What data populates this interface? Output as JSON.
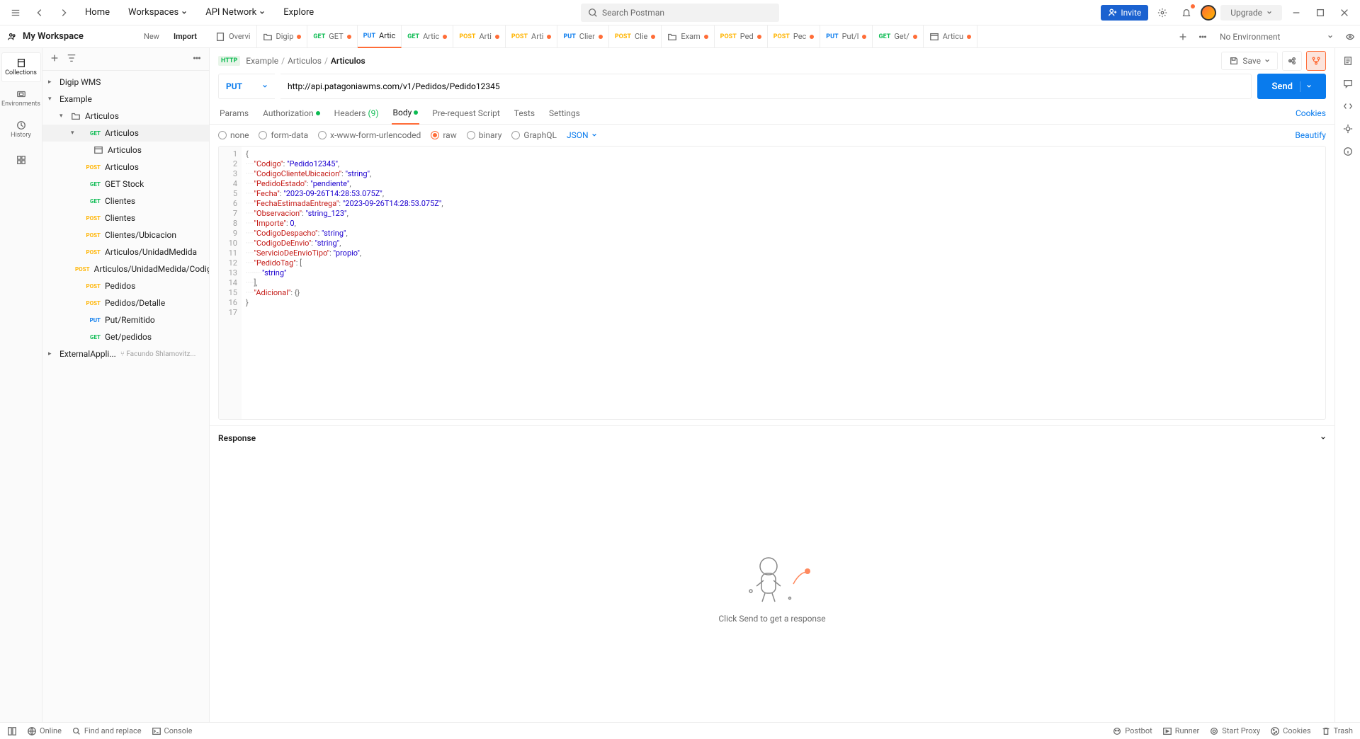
{
  "titlebar": {
    "home": "Home",
    "workspaces": "Workspaces",
    "api_network": "API Network",
    "explore": "Explore",
    "search_placeholder": "Search Postman",
    "invite": "Invite",
    "upgrade": "Upgrade"
  },
  "workspace": {
    "name": "My Workspace",
    "new": "New",
    "import": "Import"
  },
  "tabs": [
    {
      "icon": "overview",
      "label": "Overvi",
      "dot": false
    },
    {
      "icon": "folder",
      "label": "Digip",
      "dot": true
    },
    {
      "method": "GET",
      "label": "GET",
      "dot": true
    },
    {
      "method": "PUT",
      "label": "Artic",
      "dot": false,
      "active": true
    },
    {
      "method": "GET",
      "label": "Artic",
      "dot": true
    },
    {
      "method": "POST",
      "label": "Arti",
      "dot": true
    },
    {
      "method": "POST",
      "label": "Arti",
      "dot": true
    },
    {
      "method": "PUT",
      "label": "Clier",
      "dot": true
    },
    {
      "method": "POST",
      "label": "Clie",
      "dot": true
    },
    {
      "icon": "folder",
      "label": "Exam",
      "dot": true
    },
    {
      "method": "POST",
      "label": "Ped",
      "dot": true
    },
    {
      "method": "POST",
      "label": "Pec",
      "dot": true
    },
    {
      "method": "PUT",
      "label": "Put/l",
      "dot": true
    },
    {
      "method": "GET",
      "label": "Get/",
      "dot": true
    },
    {
      "icon": "example",
      "label": "Articu",
      "dot": true
    }
  ],
  "env": "No Environment",
  "leftrail": [
    {
      "label": "Collections",
      "active": true
    },
    {
      "label": "Environments"
    },
    {
      "label": "History"
    },
    {
      "label": ""
    }
  ],
  "tree": [
    {
      "level": 0,
      "arrow": "r",
      "label": "Digip WMS"
    },
    {
      "level": 0,
      "arrow": "d",
      "label": "Example"
    },
    {
      "level": 1,
      "arrow": "d",
      "folder": true,
      "label": "Articulos"
    },
    {
      "level": 2,
      "arrow": "d",
      "method": "GET",
      "label": "Articulos",
      "selected": true
    },
    {
      "level": 3,
      "example": true,
      "label": "Articulos"
    },
    {
      "level": 2,
      "method": "POST",
      "label": "Articulos"
    },
    {
      "level": 2,
      "method": "GET",
      "label": "GET Stock"
    },
    {
      "level": 2,
      "method": "GET",
      "label": "Clientes"
    },
    {
      "level": 2,
      "method": "POST",
      "label": "Clientes"
    },
    {
      "level": 2,
      "method": "POST",
      "label": "Clientes/Ubicacion"
    },
    {
      "level": 2,
      "method": "POST",
      "label": "Articulos/UnidadMedida"
    },
    {
      "level": 2,
      "method": "POST",
      "label": "Articulos/UnidadMedida/Codig..."
    },
    {
      "level": 2,
      "method": "POST",
      "label": "Pedidos"
    },
    {
      "level": 2,
      "method": "POST",
      "label": "Pedidos/Detalle"
    },
    {
      "level": 2,
      "method": "PUT",
      "label": "Put/Remitido"
    },
    {
      "level": 2,
      "method": "GET",
      "label": "Get/pedidos"
    },
    {
      "level": 0,
      "arrow": "r",
      "label": "ExternalAppli...",
      "fork": "Facundo Shlamovitz..."
    }
  ],
  "breadcrumb": {
    "badge": "HTTP",
    "parts": [
      "Example",
      "Articulos"
    ],
    "current": "Articulos"
  },
  "save": "Save",
  "request": {
    "method": "PUT",
    "url": "http://api.patagoniawms.com/v1/Pedidos/Pedido12345",
    "send": "Send"
  },
  "req_tabs": [
    {
      "label": "Params"
    },
    {
      "label": "Authorization",
      "ind": true
    },
    {
      "label": "Headers",
      "count": "(9)"
    },
    {
      "label": "Body",
      "ind": true,
      "active": true
    },
    {
      "label": "Pre-request Script"
    },
    {
      "label": "Tests"
    },
    {
      "label": "Settings"
    }
  ],
  "cookies": "Cookies",
  "body_types": [
    {
      "label": "none"
    },
    {
      "label": "form-data"
    },
    {
      "label": "x-www-form-urlencoded"
    },
    {
      "label": "raw",
      "sel": true
    },
    {
      "label": "binary"
    },
    {
      "label": "GraphQL"
    }
  ],
  "body_format": "JSON",
  "beautify": "Beautify",
  "code_lines": [
    {
      "n": 1,
      "tokens": [
        {
          "t": "p",
          "v": "{"
        }
      ]
    },
    {
      "n": 2,
      "tokens": [
        {
          "t": "i",
          "v": "    "
        },
        {
          "t": "k",
          "v": "\"Codigo\""
        },
        {
          "t": "p",
          "v": ": "
        },
        {
          "t": "s",
          "v": "\"Pedido12345\""
        },
        {
          "t": "p",
          "v": ","
        }
      ]
    },
    {
      "n": 3,
      "tokens": [
        {
          "t": "i",
          "v": "    "
        },
        {
          "t": "k",
          "v": "\"CodigoClienteUbicacion\""
        },
        {
          "t": "p",
          "v": ": "
        },
        {
          "t": "s",
          "v": "\"string\""
        },
        {
          "t": "p",
          "v": ","
        }
      ]
    },
    {
      "n": 4,
      "tokens": [
        {
          "t": "i",
          "v": "    "
        },
        {
          "t": "k",
          "v": "\"PedidoEstado\""
        },
        {
          "t": "p",
          "v": ": "
        },
        {
          "t": "s",
          "v": "\"pendiente\""
        },
        {
          "t": "p",
          "v": ","
        }
      ]
    },
    {
      "n": 5,
      "tokens": [
        {
          "t": "i",
          "v": "    "
        },
        {
          "t": "k",
          "v": "\"Fecha\""
        },
        {
          "t": "p",
          "v": ": "
        },
        {
          "t": "s",
          "v": "\"2023-09-26T14:28:53.075Z\""
        },
        {
          "t": "p",
          "v": ","
        }
      ]
    },
    {
      "n": 6,
      "tokens": [
        {
          "t": "i",
          "v": "    "
        },
        {
          "t": "k",
          "v": "\"FechaEstimadaEntrega\""
        },
        {
          "t": "p",
          "v": ": "
        },
        {
          "t": "s",
          "v": "\"2023-09-26T14:28:53.075Z\""
        },
        {
          "t": "p",
          "v": ","
        }
      ]
    },
    {
      "n": 7,
      "tokens": [
        {
          "t": "i",
          "v": "    "
        },
        {
          "t": "k",
          "v": "\"Observacion\""
        },
        {
          "t": "p",
          "v": ": "
        },
        {
          "t": "s",
          "v": "\"string_123\""
        },
        {
          "t": "p",
          "v": ","
        }
      ]
    },
    {
      "n": 8,
      "tokens": [
        {
          "t": "i",
          "v": "    "
        },
        {
          "t": "k",
          "v": "\"Importe\""
        },
        {
          "t": "p",
          "v": ": "
        },
        {
          "t": "n",
          "v": "0"
        },
        {
          "t": "p",
          "v": ","
        }
      ]
    },
    {
      "n": 9,
      "tokens": [
        {
          "t": "i",
          "v": "    "
        },
        {
          "t": "k",
          "v": "\"CodigoDespacho\""
        },
        {
          "t": "p",
          "v": ": "
        },
        {
          "t": "s",
          "v": "\"string\""
        },
        {
          "t": "p",
          "v": ","
        }
      ]
    },
    {
      "n": 10,
      "tokens": [
        {
          "t": "i",
          "v": "    "
        },
        {
          "t": "k",
          "v": "\"CodigoDeEnvio\""
        },
        {
          "t": "p",
          "v": ": "
        },
        {
          "t": "s",
          "v": "\"string\""
        },
        {
          "t": "p",
          "v": ","
        }
      ]
    },
    {
      "n": 11,
      "tokens": [
        {
          "t": "i",
          "v": "    "
        },
        {
          "t": "k",
          "v": "\"ServicioDeEnvioTipo\""
        },
        {
          "t": "p",
          "v": ": "
        },
        {
          "t": "s",
          "v": "\"propio\""
        },
        {
          "t": "p",
          "v": ","
        }
      ]
    },
    {
      "n": 12,
      "tokens": [
        {
          "t": "i",
          "v": "    "
        },
        {
          "t": "k",
          "v": "\"PedidoTag\""
        },
        {
          "t": "p",
          "v": ": ["
        }
      ]
    },
    {
      "n": 13,
      "tokens": [
        {
          "t": "i",
          "v": "        "
        },
        {
          "t": "s",
          "v": "\"string\""
        }
      ]
    },
    {
      "n": 14,
      "tokens": [
        {
          "t": "i",
          "v": "    "
        },
        {
          "t": "p",
          "v": "],"
        }
      ]
    },
    {
      "n": 15,
      "tokens": [
        {
          "t": "i",
          "v": "    "
        },
        {
          "t": "k",
          "v": "\"Adicional\""
        },
        {
          "t": "p",
          "v": ": {}"
        }
      ]
    },
    {
      "n": 16,
      "tokens": [
        {
          "t": "p",
          "v": "}"
        }
      ]
    },
    {
      "n": 17,
      "tokens": []
    }
  ],
  "response": {
    "header": "Response",
    "empty": "Click Send to get a response"
  },
  "statusbar": {
    "online": "Online",
    "find": "Find and replace",
    "console": "Console",
    "postbot": "Postbot",
    "runner": "Runner",
    "proxy": "Start Proxy",
    "cookies": "Cookies",
    "trash": "Trash"
  }
}
